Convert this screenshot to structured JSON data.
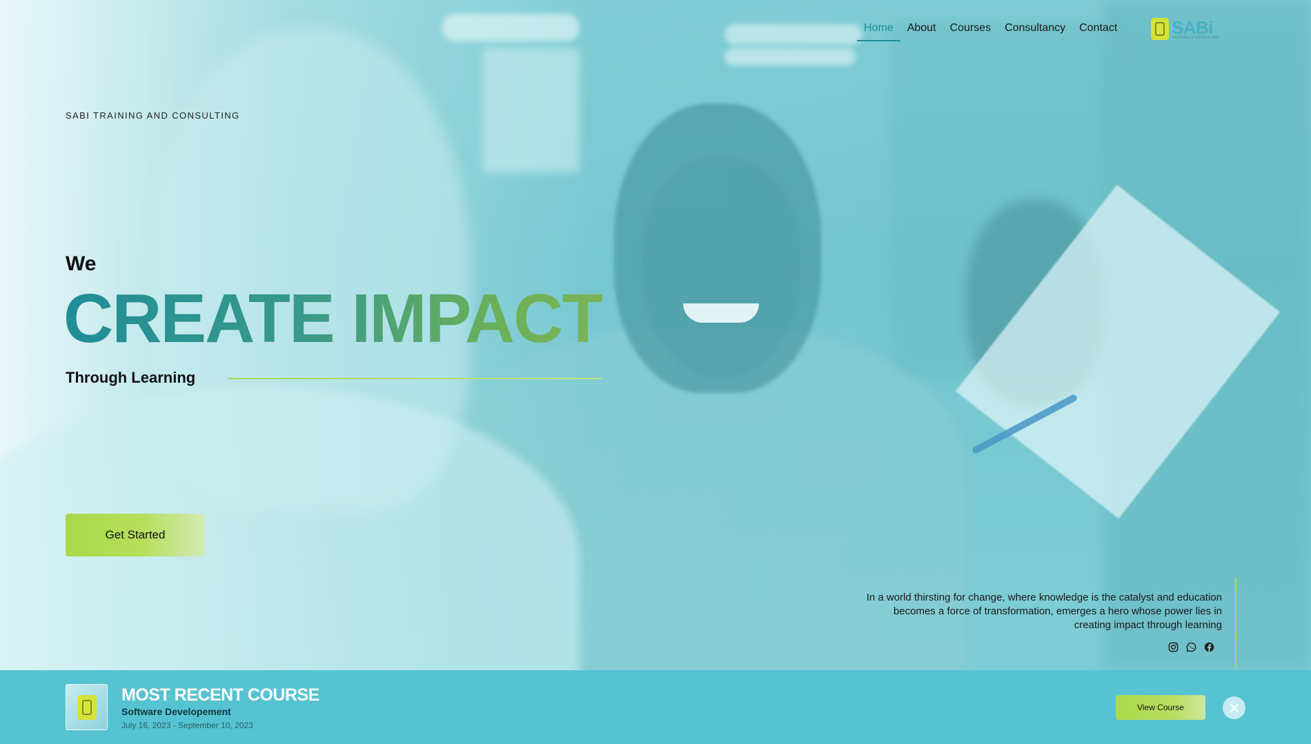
{
  "nav": {
    "items": [
      {
        "label": "Home",
        "active": true
      },
      {
        "label": "About"
      },
      {
        "label": "Courses"
      },
      {
        "label": "Consultancy"
      },
      {
        "label": "Contact"
      }
    ]
  },
  "logo": {
    "text": "SABi",
    "subtext": "TRAINING & CONSULTING",
    "colors": {
      "mark": "#d6e23a",
      "text": "#45b2c4"
    }
  },
  "hero": {
    "eyebrow": "SABI TRAINING AND CONSULTING",
    "lead": "We",
    "headline": "CREATE IMPACT",
    "sub": "Through Learning",
    "cta_label": "Get Started",
    "accent_colors": {
      "teal": "#1f8d98",
      "green": "#7cb356",
      "lime": "#a9d94a"
    }
  },
  "tagline": {
    "text": "In a world thirsting for change, where knowledge is the catalyst and education becomes a force of transformation, emerges a hero whose power lies in creating impact through learning"
  },
  "socials": {
    "icons": [
      "instagram-icon",
      "whatsapp-icon",
      "facebook-icon"
    ]
  },
  "recent_course": {
    "heading": "MOST RECENT COURSE",
    "name": "Software Developement",
    "dates": "July 16, 2023 - September 10, 2023",
    "view_label": "View Course",
    "bar_color": "#55c3d1"
  }
}
